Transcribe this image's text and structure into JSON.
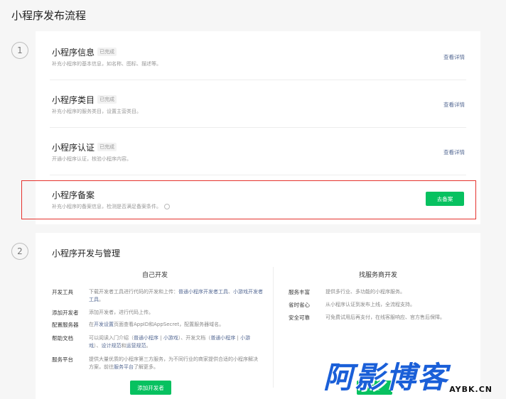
{
  "page_title": "小程序发布流程",
  "step1": {
    "number": "1",
    "rows": [
      {
        "title": "小程序信息",
        "badge": "已完成",
        "desc": "补充小程序的基本信息，如名称、图标、描述等。",
        "link": "查看详情"
      },
      {
        "title": "小程序类目",
        "badge": "已完成",
        "desc": "补充小程序的服务类目，设置主营类目。",
        "link": "查看详情"
      },
      {
        "title": "小程序认证",
        "badge": "已完成",
        "desc": "开通小程序认证，核验小程序内容。",
        "link": "查看详情"
      }
    ],
    "filing": {
      "title": "小程序备案",
      "desc": "补充小程序的备案信息，检测是否满足备案条件。",
      "info_icon": "info-circle-icon",
      "button": "去备案"
    }
  },
  "step2": {
    "number": "2",
    "title": "小程序开发与管理",
    "self_dev": {
      "title": "自己开发",
      "items": [
        {
          "label": "开发工具",
          "pre": "下载开发者工具进行代码的开发和上传：",
          "link1": "普通小程序开发者工具",
          "mid": "、",
          "link2": "小游戏开发者工具",
          "post": "。"
        },
        {
          "label": "添加开发者",
          "text": "添加开发者，进行代码上传。"
        },
        {
          "label": "配置服务器",
          "pre": "在",
          "link1": "开发设置",
          "post": "页面查看AppID和AppSecret，配置服务器域名。"
        },
        {
          "label": "帮助文档",
          "pre": "可以阅读入门介绍（",
          "link1": "普通小程序",
          "mid": " | ",
          "link2": "小游戏",
          "mid2": "）、开发文档（",
          "link3": "普通小程",
          "link4": "序",
          "mid3": " | ",
          "link5": "小游戏",
          "mid4": "）、",
          "link6": "设计规范",
          "mid5": "和",
          "link7": "运营规范",
          "post": "。"
        },
        {
          "label": "服务平台",
          "pre": "提供大量优质的小程序第三方服务，为不同行业的商家提供合适的小程序解决方案，前往",
          "link1": "服务平台",
          "post": "了解更多。"
        }
      ],
      "button": "添加开发者"
    },
    "provider_dev": {
      "title": "找服务商开发",
      "items": [
        {
          "label": "服务丰富",
          "text": "提供多行业、多功能的小程序服务。"
        },
        {
          "label": "省时省心",
          "text": "从小程序认证到发布上线，全流程支持。"
        },
        {
          "label": "安全可靠",
          "text": "可免费试用后再支付，在线客服响应、官方售后保障。"
        }
      ],
      "button": "前往"
    }
  },
  "watermark": {
    "main": "阿影博客",
    "sub": "AYBK.CN"
  },
  "colors": {
    "accent_green": "#07c160",
    "link_blue": "#576b95",
    "highlight_red": "#e5322d",
    "watermark_blue": "#1a5fd8"
  }
}
